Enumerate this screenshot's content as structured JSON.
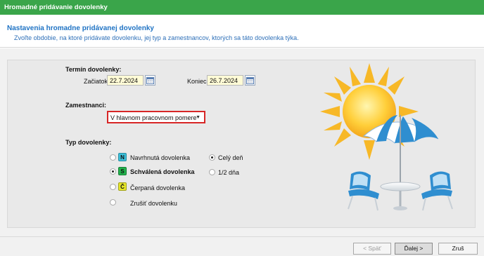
{
  "window": {
    "title": "Hromadné pridávanie dovolenky"
  },
  "header": {
    "title": "Nastavenia hromadne pridávanej dovolenky",
    "subtitle": "Zvoľte obdobie, na ktoré pridávate dovolenku, jej typ a zamestnancov, ktorých sa táto dovolenka týka."
  },
  "term": {
    "section_label": "Termín dovolenky:",
    "start_label": "Začiatok",
    "start_value": "22.7.2024",
    "end_label": "Koniec",
    "end_value": "26.7.2024"
  },
  "employees": {
    "label": "Zamestnanci:",
    "selected": "V hlavnom pracovnom pomere"
  },
  "leave_type": {
    "label": "Typ dovolenky:",
    "options": [
      {
        "badge": "N",
        "badge_color": "#3bbfd9",
        "label": "Navrhnutá dovolenka",
        "checked": false
      },
      {
        "badge": "S",
        "badge_color": "#22b14c",
        "label": "Schválená dovolenka",
        "checked": true
      },
      {
        "badge": "Č",
        "badge_color": "#e5e52a",
        "label": "Čerpaná dovolenka",
        "checked": false
      },
      {
        "badge": "",
        "badge_color": "",
        "label": "Zrušiť dovolenku",
        "checked": false
      }
    ],
    "duration": [
      {
        "label": "Celý deň",
        "checked": true
      },
      {
        "label": "1/2 dňa",
        "checked": false
      }
    ]
  },
  "buttons": {
    "back": "< Späť",
    "next": "Ďalej >",
    "cancel": "Zruš"
  },
  "illustration": {
    "icon": "sun-umbrella-beach-chairs-illustration"
  }
}
